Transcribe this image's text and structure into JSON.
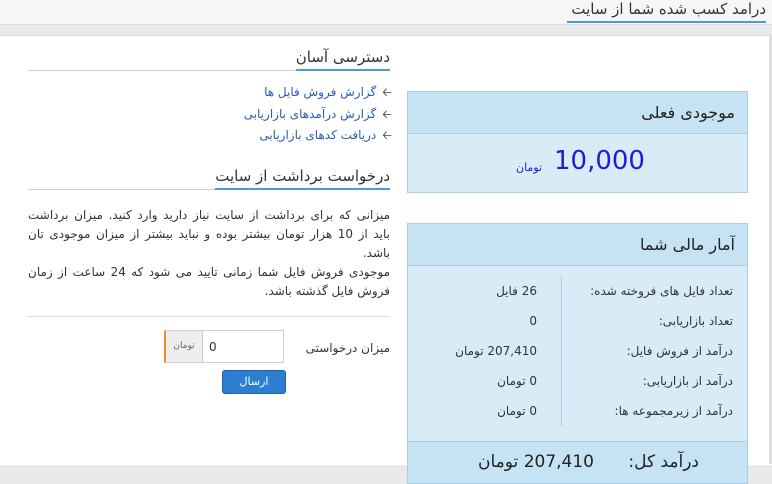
{
  "page_title": "درامد کسب شده شما از سایت",
  "balance": {
    "title": "موجودی فعلی",
    "amount": "10,000",
    "unit": "تومان"
  },
  "stats": {
    "title": "آمار مالی شما",
    "rows": [
      {
        "label": "تعداد فایل های فروخته شده:",
        "value": "26 فایل"
      },
      {
        "label": "تعداد بازاریابی:",
        "value": "0"
      },
      {
        "label": "درآمد از فروش فایل:",
        "value": "207,410 تومان"
      },
      {
        "label": "درآمد از بازاریابی:",
        "value": "0 تومان"
      },
      {
        "label": "درآمد از زیرمجموعه ها:",
        "value": "0 تومان"
      }
    ],
    "total_label": "درآمد کل:",
    "total_value": "207,410 تومان"
  },
  "quick_access": {
    "title": "دسترسی آسان",
    "links": [
      "گزارش فروش فایل ها",
      "گزارش درآمدهای بازاریابی",
      "دریافت کدهای بازاریابی"
    ]
  },
  "withdraw": {
    "title": "درخواست برداشت از سایت",
    "description_1": "میزانی که برای برداشت از سایت نیاز دارید وارد کنید. میزان برداشت باید از 10 هزار تومان بیشتر بوده و نباید بیشتر از میزان موجودی تان باشد.",
    "description_2": "موجودی فروش فایل شما زمانی تایید می شود که 24 ساعت از زمان فروش فایل گذشته باشد.",
    "amount_label": "میزان درخواستی",
    "amount_value": "0",
    "amount_unit": "تومان",
    "submit_label": "ارسال"
  }
}
